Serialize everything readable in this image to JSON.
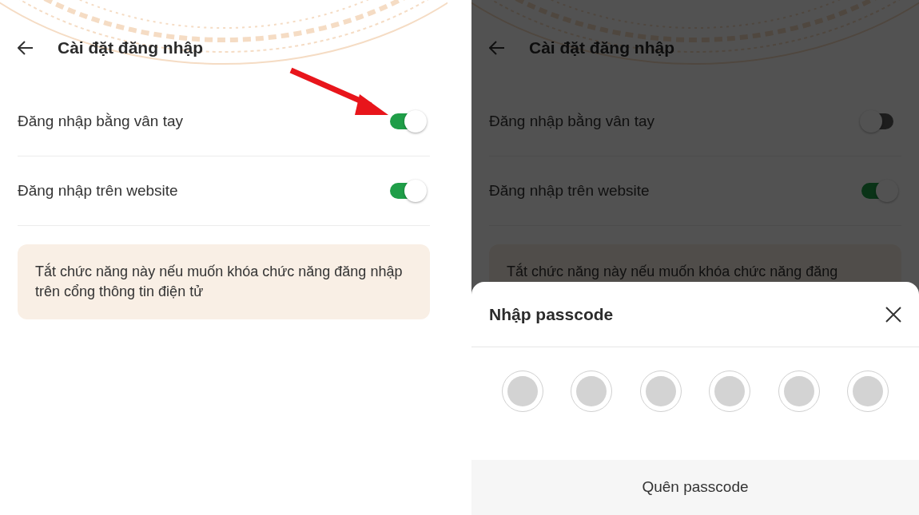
{
  "panels": [
    {
      "title": "Cài đặt đăng nhập",
      "dimmed": false,
      "settings": [
        {
          "label": "Đăng nhập bằng vân tay",
          "on": true
        },
        {
          "label": "Đăng nhập trên website",
          "on": true
        }
      ],
      "note": "Tắt chức năng này nếu muốn khóa chức năng đăng nhập trên cổng thông tin điện tử"
    },
    {
      "title": "Cài đặt đăng nhập",
      "dimmed": true,
      "settings": [
        {
          "label": "Đăng nhập bằng vân tay",
          "on": false
        },
        {
          "label": "Đăng nhập trên website",
          "on": true
        }
      ],
      "note": "Tắt chức năng này nếu muốn khóa chức năng đăng",
      "sheet": {
        "title": "Nhập passcode",
        "dots": [
          {
            "filled": false
          },
          {
            "filled": false
          },
          {
            "filled": false
          },
          {
            "filled": false
          },
          {
            "filled": false
          },
          {
            "filled": false
          }
        ],
        "forgot": "Quên passcode"
      }
    }
  ]
}
